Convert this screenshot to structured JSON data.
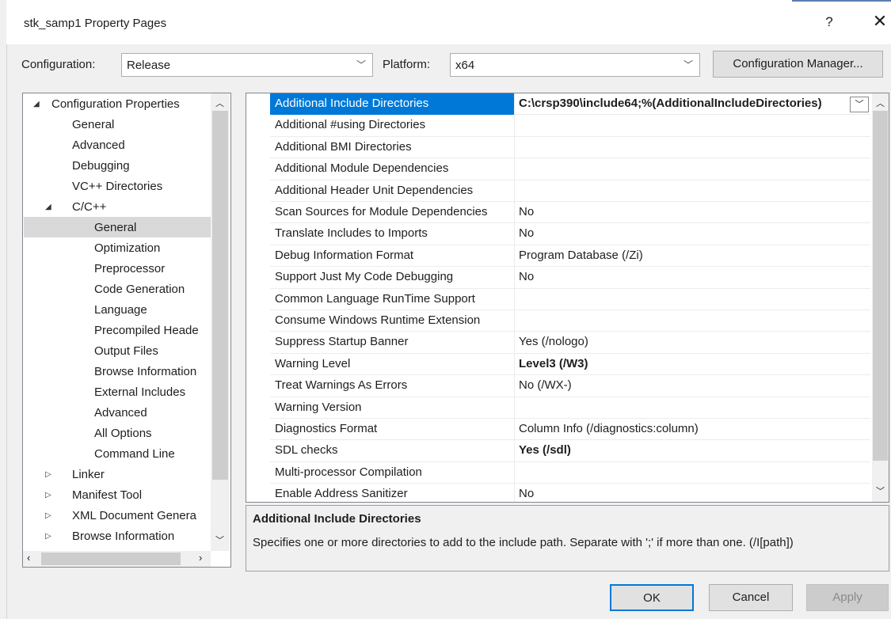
{
  "window": {
    "title": "stk_samp1 Property Pages",
    "help_glyph": "?",
    "close_glyph": "✕"
  },
  "config": {
    "configuration_label": "Configuration:",
    "configuration_value": "Release",
    "platform_label": "Platform:",
    "platform_value": "x64",
    "manager_button": "Configuration Manager..."
  },
  "tree": {
    "items": [
      {
        "label": "Configuration Properties",
        "level": 0,
        "state": "expanded"
      },
      {
        "label": "General",
        "level": 1,
        "state": "leaf"
      },
      {
        "label": "Advanced",
        "level": 1,
        "state": "leaf"
      },
      {
        "label": "Debugging",
        "level": 1,
        "state": "leaf"
      },
      {
        "label": "VC++ Directories",
        "level": 1,
        "state": "leaf"
      },
      {
        "label": "C/C++",
        "level": 1,
        "state": "expanded"
      },
      {
        "label": "General",
        "level": 2,
        "state": "leaf",
        "selected": true
      },
      {
        "label": "Optimization",
        "level": 2,
        "state": "leaf"
      },
      {
        "label": "Preprocessor",
        "level": 2,
        "state": "leaf"
      },
      {
        "label": "Code Generation",
        "level": 2,
        "state": "leaf"
      },
      {
        "label": "Language",
        "level": 2,
        "state": "leaf"
      },
      {
        "label": "Precompiled Heade",
        "level": 2,
        "state": "leaf"
      },
      {
        "label": "Output Files",
        "level": 2,
        "state": "leaf"
      },
      {
        "label": "Browse Information",
        "level": 2,
        "state": "leaf"
      },
      {
        "label": "External Includes",
        "level": 2,
        "state": "leaf"
      },
      {
        "label": "Advanced",
        "level": 2,
        "state": "leaf"
      },
      {
        "label": "All Options",
        "level": 2,
        "state": "leaf"
      },
      {
        "label": "Command Line",
        "level": 2,
        "state": "leaf"
      },
      {
        "label": "Linker",
        "level": 1,
        "state": "collapsed"
      },
      {
        "label": "Manifest Tool",
        "level": 1,
        "state": "collapsed"
      },
      {
        "label": "XML Document Genera",
        "level": 1,
        "state": "collapsed"
      },
      {
        "label": "Browse Information",
        "level": 1,
        "state": "collapsed"
      }
    ]
  },
  "grid": {
    "rows": [
      {
        "name": "Additional Include Directories",
        "value": "C:\\crsp390\\include64;%(AdditionalIncludeDirectories)",
        "bold": true,
        "selected": true
      },
      {
        "name": "Additional #using Directories",
        "value": "",
        "bold": false
      },
      {
        "name": "Additional BMI Directories",
        "value": "",
        "bold": false
      },
      {
        "name": "Additional Module Dependencies",
        "value": "",
        "bold": false
      },
      {
        "name": "Additional Header Unit Dependencies",
        "value": "",
        "bold": false
      },
      {
        "name": "Scan Sources for Module Dependencies",
        "value": "No",
        "bold": false
      },
      {
        "name": "Translate Includes to Imports",
        "value": "No",
        "bold": false
      },
      {
        "name": "Debug Information Format",
        "value": "Program Database (/Zi)",
        "bold": false
      },
      {
        "name": "Support Just My Code Debugging",
        "value": "No",
        "bold": false
      },
      {
        "name": "Common Language RunTime Support",
        "value": "",
        "bold": false
      },
      {
        "name": "Consume Windows Runtime Extension",
        "value": "",
        "bold": false
      },
      {
        "name": "Suppress Startup Banner",
        "value": "Yes (/nologo)",
        "bold": false
      },
      {
        "name": "Warning Level",
        "value": "Level3 (/W3)",
        "bold": true
      },
      {
        "name": "Treat Warnings As Errors",
        "value": "No (/WX-)",
        "bold": false
      },
      {
        "name": "Warning Version",
        "value": "",
        "bold": false
      },
      {
        "name": "Diagnostics Format",
        "value": "Column Info (/diagnostics:column)",
        "bold": false
      },
      {
        "name": "SDL checks",
        "value": "Yes (/sdl)",
        "bold": true
      },
      {
        "name": "Multi-processor Compilation",
        "value": "",
        "bold": false
      },
      {
        "name": "Enable Address Sanitizer",
        "value": "No",
        "bold": false
      }
    ]
  },
  "description": {
    "title": "Additional Include Directories",
    "text": "Specifies one or more directories to add to the include path. Separate with ';' if more than one. (/I[path])"
  },
  "buttons": {
    "ok": "OK",
    "cancel": "Cancel",
    "apply": "Apply"
  },
  "colors": {
    "selection": "#0078d7",
    "tree_selection": "#d9d9d9",
    "disabled_text": "#8a8a8a"
  }
}
